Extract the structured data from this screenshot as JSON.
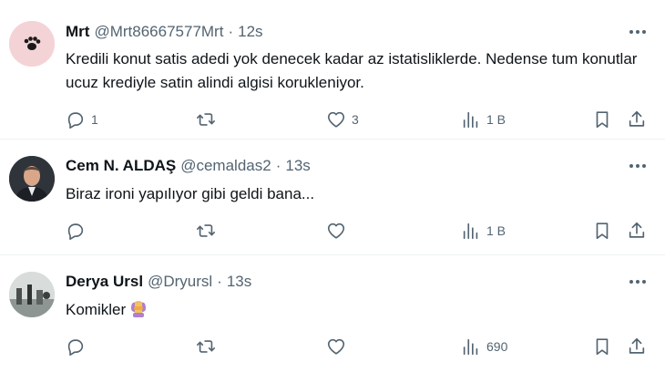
{
  "tweets": [
    {
      "name": "Mrt",
      "handle": "@Mrt86667577Mrt",
      "separator": "·",
      "time": "12s",
      "text": "Kredili konut satis adedi yok denecek kadar az istatisliklerde. Nedense tum konutlar ucuz krediyle satin alindi algisi korukleniyor.",
      "replies": "1",
      "retweets": "",
      "likes": "3",
      "views": "1 B"
    },
    {
      "name": "Cem N. ALDAŞ",
      "handle": "@cemaldas2",
      "separator": "·",
      "time": "13s",
      "text": "Biraz ironi yapılıyor gibi geldi bana...",
      "replies": "",
      "retweets": "",
      "likes": "",
      "views": "1 B"
    },
    {
      "name": "Derya Ursl",
      "handle": "@Dryursl",
      "separator": "·",
      "time": "13s",
      "text": "Komikler",
      "replies": "",
      "retweets": "",
      "likes": "",
      "views": "690"
    }
  ],
  "icons": {
    "reply": "reply-icon",
    "retweet": "retweet-icon",
    "like": "heart-icon",
    "views": "views-icon",
    "bookmark": "bookmark-icon",
    "share": "share-icon",
    "more": "more-icon",
    "emoji": "facepalm-emoji"
  },
  "colors": {
    "text": "#0f1419",
    "secondary": "#536471",
    "divider": "#eff3f4"
  }
}
